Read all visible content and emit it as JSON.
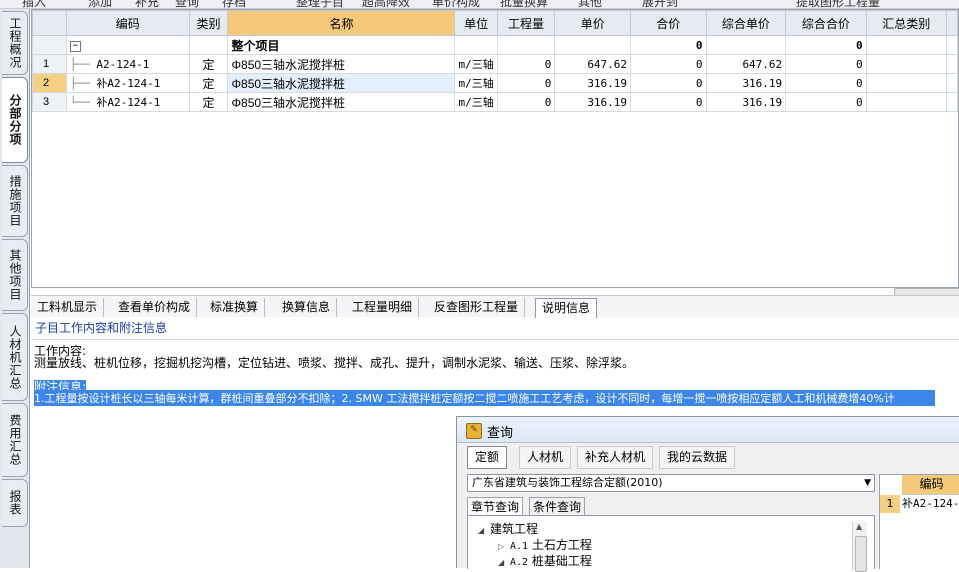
{
  "toolbar": {
    "items": [
      "插入",
      "添加",
      "补充",
      "查询",
      "存档",
      "整理子目",
      "超高降效",
      "单价构成",
      "批量换算",
      "其他",
      "展开到",
      "提取图形工程量"
    ]
  },
  "left_tabs": [
    {
      "label": "工程概况",
      "active": false
    },
    {
      "label": "分部分项",
      "active": true
    },
    {
      "label": "措施项目",
      "active": false
    },
    {
      "label": "其他项目",
      "active": false
    },
    {
      "label": "人材机汇总",
      "active": false
    },
    {
      "label": "费用汇总",
      "active": false
    },
    {
      "label": "报表",
      "active": false
    }
  ],
  "grid": {
    "columns": [
      "编码",
      "类别",
      "名称",
      "单位",
      "工程量",
      "单价",
      "合价",
      "综合单价",
      "综合合价",
      "汇总类别"
    ],
    "group_row": {
      "toggle": "−",
      "name": "整个项目",
      "total": "0",
      "comp_total": "0"
    },
    "rows": [
      {
        "no": "1",
        "code": "A2-124-1",
        "type": "定",
        "name": "Φ850三轴水泥搅拌桩",
        "unit": "m/三轴",
        "qty": "0",
        "price": "647.62",
        "total": "0",
        "comp_price": "647.62",
        "comp_total": "0",
        "summary": ""
      },
      {
        "no": "2",
        "code": "补A2-124-1",
        "type": "定",
        "name": "Φ850三轴水泥搅拌桩",
        "unit": "m/三轴",
        "qty": "0",
        "price": "316.19",
        "total": "0",
        "comp_price": "316.19",
        "comp_total": "0",
        "summary": ""
      },
      {
        "no": "3",
        "code": "补A2-124-1",
        "type": "定",
        "name": "Φ850三轴水泥搅拌桩",
        "unit": "m/三轴",
        "qty": "0",
        "price": "316.19",
        "total": "0",
        "comp_price": "316.19",
        "comp_total": "0",
        "summary": ""
      }
    ]
  },
  "bottom_tabs": [
    "工料机显示",
    "查看单价构成",
    "标准换算",
    "换算信息",
    "工程量明细",
    "反查图形工程量",
    "说明信息"
  ],
  "subtitle": "子目工作内容和附注信息",
  "description": {
    "work_heading": "工作内容:",
    "work_text": "测量放线、桩机位移，挖掘机挖沟槽，定位钻进、喷浆、搅拌、成孔、提升，调制水泥浆、输送、压浆、除浮浆。",
    "note_heading": "附注信息:",
    "note_text": "1.工程量按设计桩长以三轴每米计算，群桩间重叠部分不扣除；2. SMW 工法搅拌桩定额按二搅二喷施工工艺考虑，设计不同时，每增一搅一喷按相应定额人工和机械费增40%计"
  },
  "dialog": {
    "title": "查询",
    "tabs": [
      "定额",
      "人材机",
      "补充人材机",
      "我的云数据"
    ],
    "select_value": "广东省建筑与装饰工程综合定额(2010)",
    "subtabs": [
      "章节查询",
      "条件查询"
    ],
    "tree": [
      {
        "toggle": "◢",
        "code": "",
        "label": "建筑工程",
        "level": 0
      },
      {
        "toggle": "▷",
        "code": "A.1",
        "label": "土石方工程",
        "level": 1
      },
      {
        "toggle": "◢",
        "code": "A.2",
        "label": "桩基础工程",
        "level": 1
      }
    ],
    "result_header": "编码",
    "result_rows": [
      {
        "no": "1",
        "code": "补A2-124-"
      }
    ]
  }
}
